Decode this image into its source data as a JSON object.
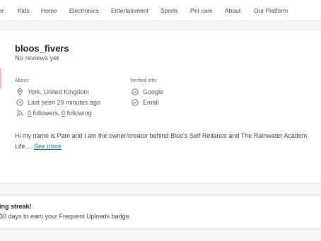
{
  "nav": {
    "items": [
      "er",
      "Kids",
      "Home",
      "Electronics",
      "Entertainment",
      "Sports",
      "Pet care",
      "About",
      "Our Platform"
    ]
  },
  "profile": {
    "username": "bloos_fivers",
    "reviews": "No reviews yet",
    "about_label": "About:",
    "location": "York, United Kingdom",
    "last_seen": "Last seen 29 minutes ago",
    "followers_count": "0",
    "followers_text": "followers,",
    "following_count": "0",
    "following_text": "following",
    "verified_label": "Verified info:",
    "verified": [
      "Google",
      "Email"
    ],
    "bio_line1": "Hi my name is Pam and I am the owner/creator behind Bloo's Self Reliance and The Rainwater Academ",
    "bio_line2": "Life....",
    "see_more": "See more"
  },
  "streak": {
    "title": "ing streak!",
    "text": "30 days to earn your Frequent Uploads badge."
  },
  "colors": {
    "link": "#0e7a8c",
    "avatar": "#f2b6cd"
  },
  "icons": [
    "location-pin-icon",
    "clock-icon",
    "rss-icon",
    "check-circle-icon"
  ]
}
